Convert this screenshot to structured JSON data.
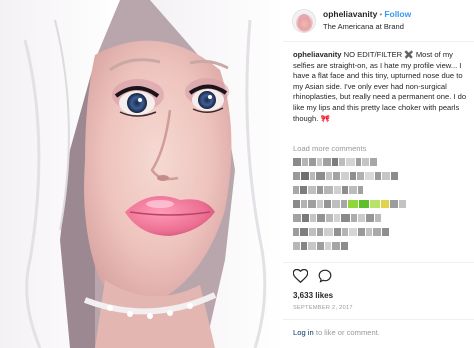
{
  "header": {
    "username": "opheliavanity",
    "separator": "•",
    "follow_label": "Follow",
    "location": "The Americana at Brand"
  },
  "caption": {
    "username": "opheliavanity",
    "text": "NO EDIT/FILTER ✖️ Most of my selfies are straight-on, as I hate my profile view... I have a flat face and this tiny, upturned nose due to my Asian side. I've only ever had non-surgical rhinoplasties, but really need a permanent one. I do like my lips and this pretty lace choker with pearls though.",
    "emoji": "🎀"
  },
  "load_more_label": "Load more comments",
  "likes": "3,633 likes",
  "date": "September 2, 2017",
  "login": {
    "link_label": "Log in",
    "rest": "to like or comment."
  },
  "icons": {
    "like": "heart-icon",
    "comment": "comment-icon"
  },
  "colors": {
    "link": "#3897f0",
    "text": "#262626",
    "muted": "#999999",
    "login_link": "#003569"
  }
}
